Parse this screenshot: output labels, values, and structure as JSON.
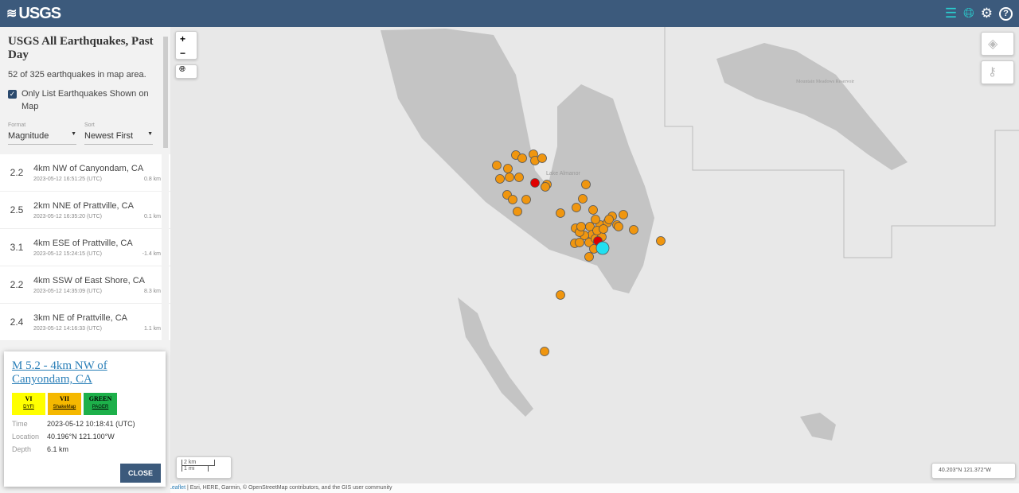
{
  "header": {
    "logo": "USGS",
    "icons": [
      "list-icon",
      "globe-icon",
      "gear-icon",
      "help-icon"
    ]
  },
  "sidebar": {
    "title": "USGS All Earthquakes, Past Day",
    "count": "52 of 325 earthquakes in map area.",
    "only_list_label": "Only List Earthquakes Shown on Map",
    "only_list_checked": true,
    "format_label": "Format",
    "format_value": "Magnitude",
    "sort_label": "Sort",
    "sort_value": "Newest First",
    "items": [
      {
        "mag": "2.2",
        "place": "4km NW of Canyondam, CA",
        "time": "2023-05-12 16:51:25 (UTC)",
        "depth": "0.8 km"
      },
      {
        "mag": "2.5",
        "place": "2km NNE of Prattville, CA",
        "time": "2023-05-12 16:35:20 (UTC)",
        "depth": "0.1 km"
      },
      {
        "mag": "3.1",
        "place": "4km ESE of Prattville, CA",
        "time": "2023-05-12 15:24:15 (UTC)",
        "depth": "-1.4 km"
      },
      {
        "mag": "2.2",
        "place": "4km SSW of East Shore, CA",
        "time": "2023-05-12 14:35:09 (UTC)",
        "depth": "8.3 km"
      },
      {
        "mag": "2.4",
        "place": "3km NE of Prattville, CA",
        "time": "2023-05-12 14:16:33 (UTC)",
        "depth": "1.1 km"
      }
    ]
  },
  "popup": {
    "title": "M 5.2 - 4km NW of Canyondam, CA",
    "badges": [
      {
        "value": "VI",
        "label": "DYFI",
        "color": "#ffff00"
      },
      {
        "value": "VII",
        "label": "ShakeMap",
        "color": "#f5b800"
      },
      {
        "value": "GREEN",
        "label": "PAGER",
        "color": "#1db04a"
      }
    ],
    "time_label": "Time",
    "time": "2023-05-12 10:18:41 (UTC)",
    "location_label": "Location",
    "location": "40.196°N 121.100°W",
    "depth_label": "Depth",
    "depth": "6.1 km",
    "close": "CLOSE"
  },
  "map": {
    "zoom_in": "+",
    "zoom_out": "−",
    "lake_label": "Lake Almanor",
    "reservoir_label": "Mountain Meadows Reservoir",
    "scale_km": "2 km",
    "scale_mi": "1 mi",
    "coordinates": "40.203°N 121.372°W",
    "attribution_link": "Leaflet",
    "attribution": " | Esri, HERE, Garmin, © OpenStreetMap contributors, and the GIS user community",
    "colors": {
      "quake": "#f0960f",
      "recent": "#e00000",
      "selected": "#22e0f0",
      "water": "#c4c4c4",
      "land": "#e8e8e8"
    }
  }
}
